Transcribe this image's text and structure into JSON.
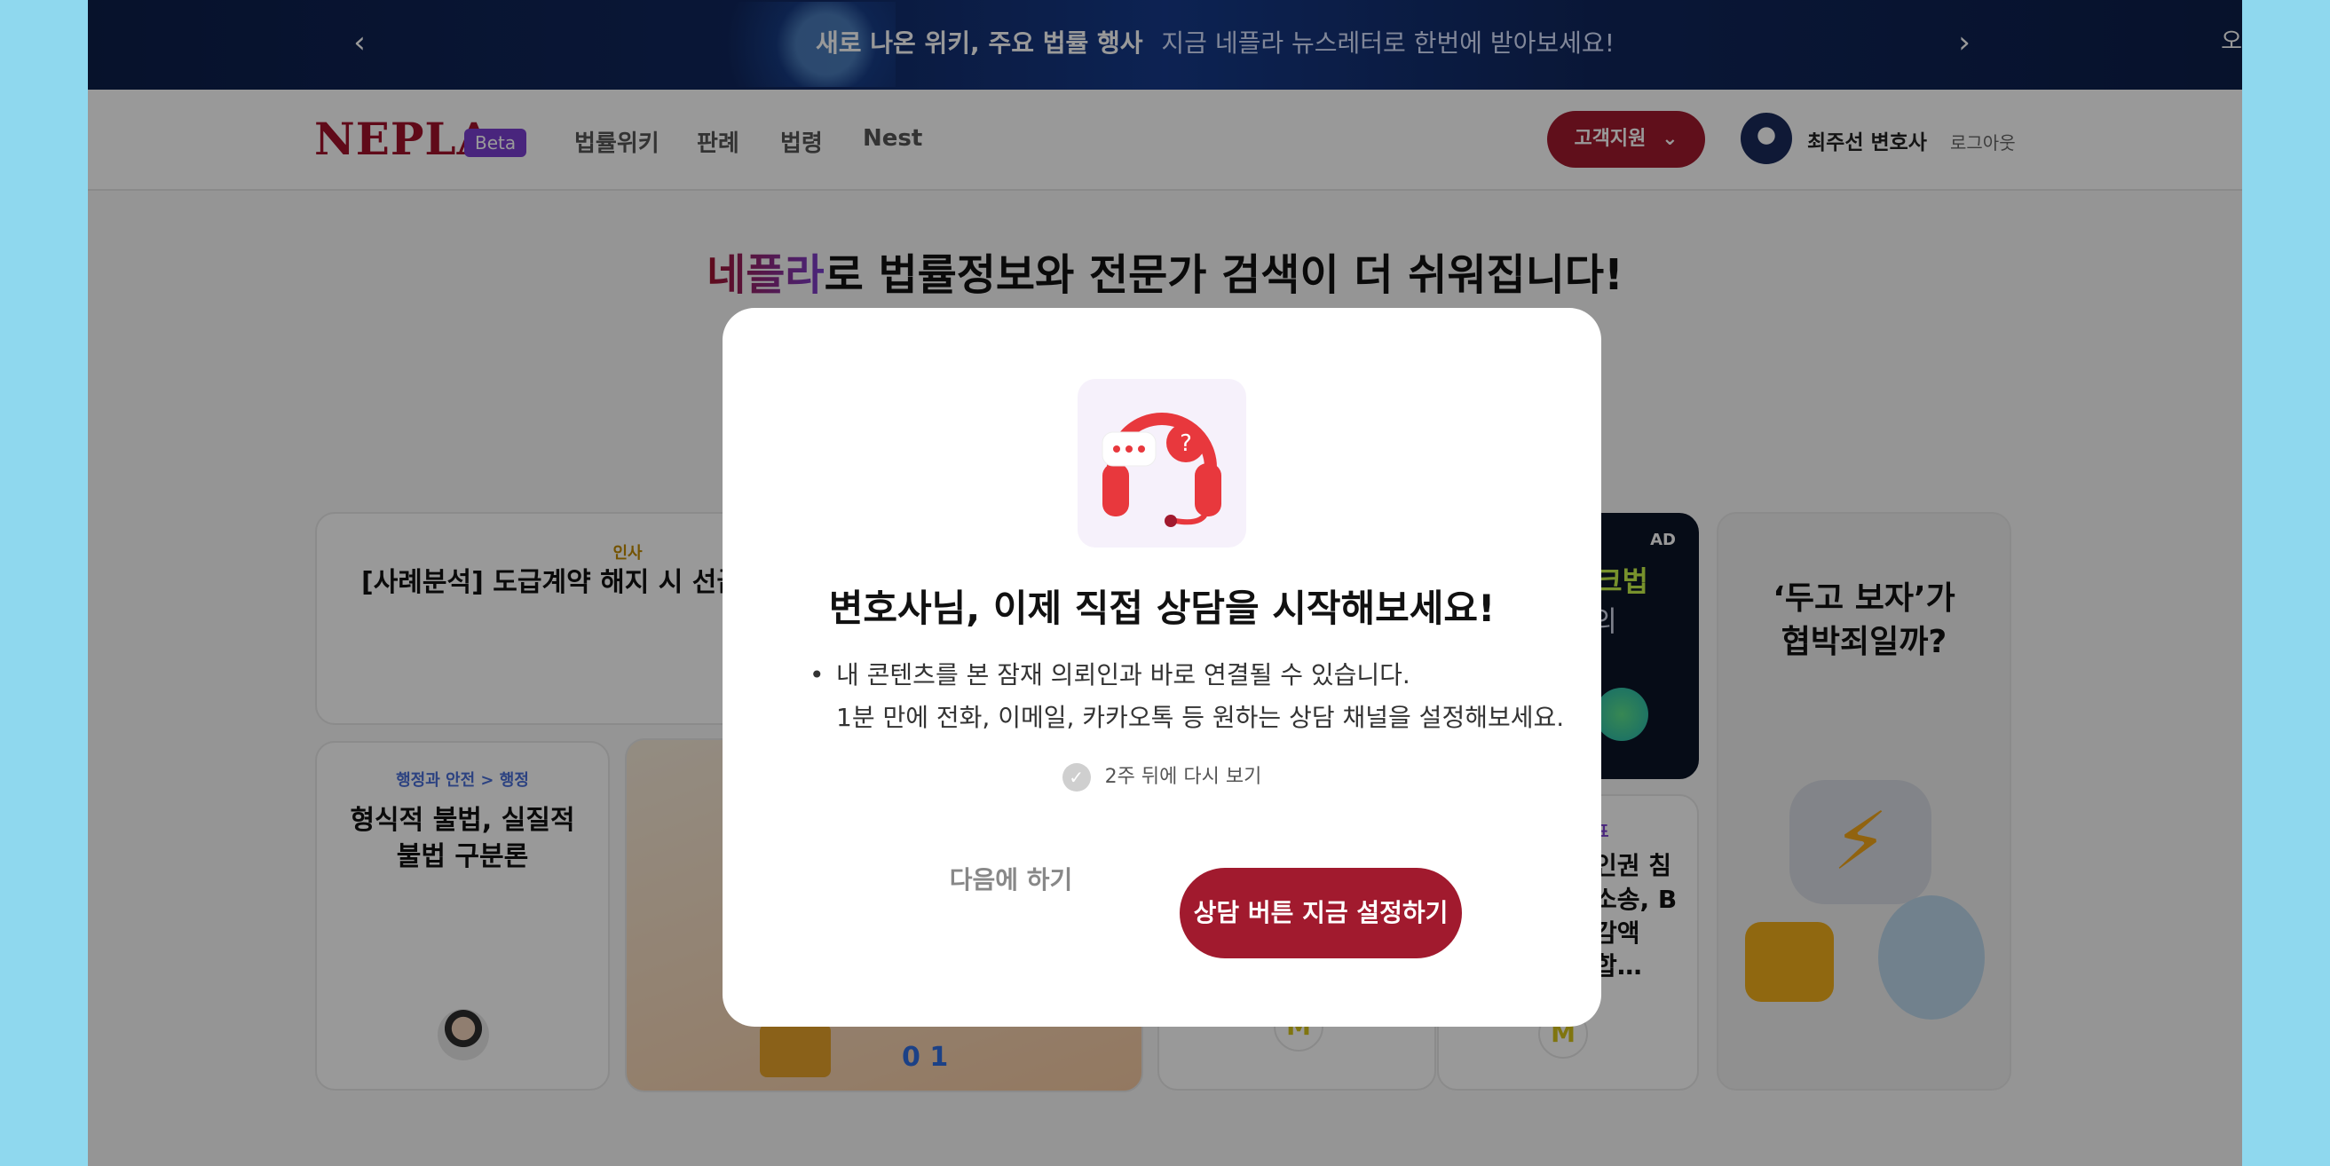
{
  "banner": {
    "prev_icon": "chevron-left-icon",
    "next_icon": "chevron-right-icon",
    "headline": "새로 나온 위키, 주요 법률 행사",
    "subtext": "지금 네플라 뉴스레터로 한번에 받아보세요!",
    "edge_text": "오"
  },
  "header": {
    "logo": "NEPLA",
    "beta": "Beta",
    "nav": [
      "법률위키",
      "판례",
      "법령",
      "Nest"
    ],
    "support": "고객지원",
    "user": "최주선 변호사",
    "logout": "로그아웃"
  },
  "headline": {
    "brand": "네플라",
    "rest": "로 법률정보와 전문가 검색이 더 쉬워집니다!"
  },
  "cards": {
    "c1_cat": "인사",
    "c1_title": "[사례분석] 도급계약 해지 시 선급금",
    "c2_cat": "행정과 안전 > 행정",
    "c2_title": "형식적 불법, 실질적 불법 구분론",
    "ad": "AD",
    "ad_text1": "크법",
    "ad_text2": "의",
    "c4_cat": "표",
    "c4_title": "인권 침소송, B감액합…",
    "c5_title": "‘두고 보자’가 협박죄일까?"
  },
  "modal": {
    "title": "변호사님, 이제 직접 상담을 시작해보세요!",
    "line1": "내 콘텐츠를 본 잠재 의뢰인과 바로 연결될 수 있습니다.",
    "line2": "1분 만에 전화, 이메일, 카카오톡 등 원하는 상담 채널을 설정해보세요.",
    "remind": "2주 뒤에 다시 보기",
    "later": "다음에 하기",
    "cta": "상담 버튼 지금 설정하기"
  },
  "colors": {
    "brand": "#a11a2e",
    "beta": "#7b3fd1",
    "banner_bg": "#0c1e49"
  }
}
